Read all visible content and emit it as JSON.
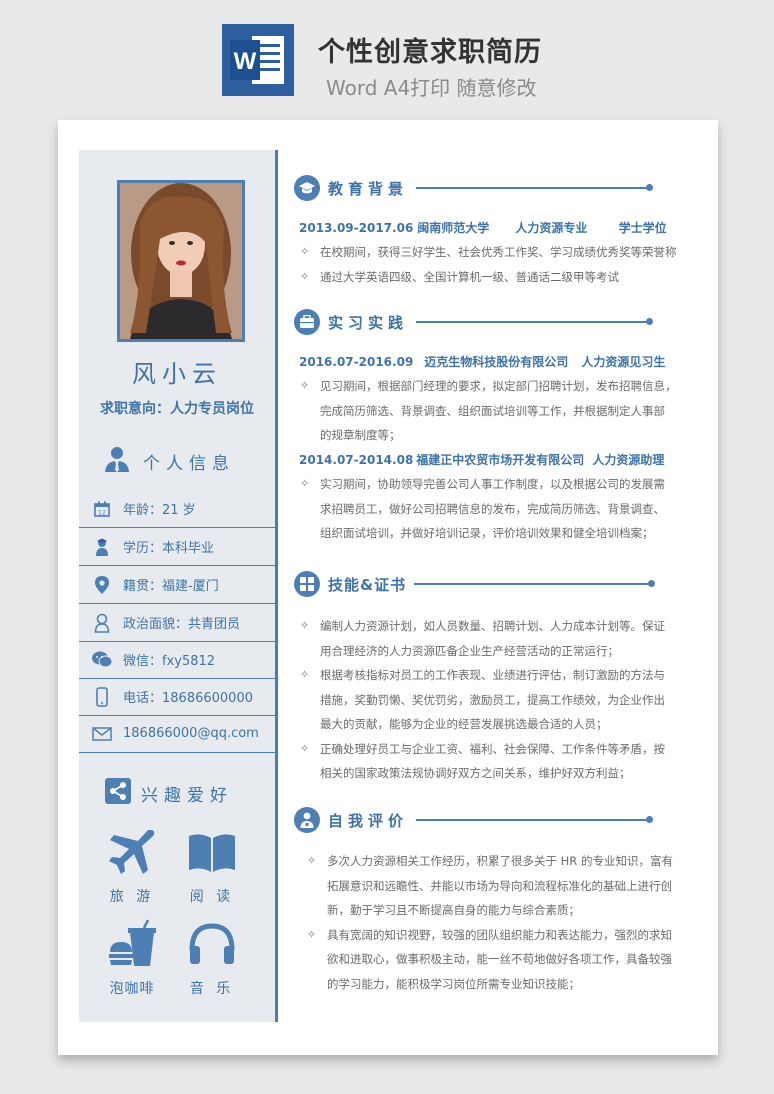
{
  "header": {
    "logo_letter": "W",
    "title": "个性创意求职简历",
    "subtitle": "Word A4打印 随意修改"
  },
  "profile": {
    "name": "风小云",
    "intent": "求职意向：人力专员岗位"
  },
  "personal_info": {
    "title": "个人信息",
    "items": [
      {
        "icon": "calendar-icon",
        "text": "年龄：21 岁"
      },
      {
        "icon": "graduate-icon",
        "text": "学历：本科毕业"
      },
      {
        "icon": "location-pin-icon",
        "text": "籍贯：福建-厦门"
      },
      {
        "icon": "person-icon",
        "text": "政治面貌：共青团员"
      },
      {
        "icon": "wechat-icon",
        "text": "微信：fxy5812"
      },
      {
        "icon": "phone-icon",
        "text": "电话：18686600000"
      },
      {
        "icon": "mail-icon",
        "text": "186866000@qq.com"
      }
    ]
  },
  "hobbies": {
    "title": "兴趣爱好",
    "items": [
      {
        "icon": "airplane-icon",
        "label": "旅 游"
      },
      {
        "icon": "book-icon",
        "label": "阅 读"
      },
      {
        "icon": "coffee-burger-icon",
        "label": "泡咖啡"
      },
      {
        "icon": "headphones-icon",
        "label": "音 乐"
      }
    ]
  },
  "education": {
    "title": "教育背景",
    "period": "2013.09-2017.06",
    "school": "闽南师范大学",
    "major": "人力资源专业",
    "degree": "学士学位",
    "bullets": [
      "在校期间，获得三好学生、社会优秀工作奖、学习成绩优秀奖等荣誉称",
      "通过大学英语四级、全国计算机一级、普通话二级甲等考试"
    ]
  },
  "internship": {
    "title": "实习实践",
    "jobs": [
      {
        "period": "2016.07-2016.09",
        "company": "迈克生物科技股份有限公司",
        "role": "人力资源见习生",
        "lines": [
          "见习期间，根据部门经理的要求，拟定部门招聘计划，发布招聘信息，",
          "完成简历筛选、背景调查、组织面试培训等工作，并根据制定人事部",
          "的规章制度等；"
        ]
      },
      {
        "period": "2014.07-2014.08",
        "company": "福建正中农贸市场开发有限公司",
        "role": "人力资源助理",
        "lines": [
          "实习期间，协助领导完善公司人事工作制度，以及根据公司的发展需",
          "求招聘员工，做好公司招聘信息的发布，完成简历筛选、背景调查、",
          "组织面试培训，并做好培训记录，评价培训效果和健全培训档案；"
        ]
      }
    ]
  },
  "skills": {
    "title": "技能&证书",
    "bullets": [
      [
        "编制人力资源计划，如人员数量、招聘计划、人力成本计划等。保证",
        "用合理经济的人力资源匹备企业生产经营活动的正常运行；"
      ],
      [
        "根据考核指标对员工的工作表现、业绩进行评估，制订激励的方法与",
        "措施，奖勤罚懒、奖优罚劣，激励员工，提高工作绩效，为企业作出",
        "最大的贡献，能够为企业的经营发展挑选最合适的人员；"
      ],
      [
        "正确处理好员工与企业工资、福利、社会保障、工作条件等矛盾，按",
        "相关的国家政策法规协调好双方之间关系，维护好双方利益；"
      ]
    ]
  },
  "self_eval": {
    "title": "自我评价",
    "bullets": [
      [
        "多次人力资源相关工作经历，积累了很多关于 HR 的专业知识，富有",
        "拓展意识和远瞻性、并能以市场为导向和流程标准化的基础上进行创",
        "新，勤于学习且不断提高自身的能力与综合素质；"
      ],
      [
        "具有宽阔的知识视野，较强的团队组织能力和表达能力，强烈的求知",
        "欲和进取心，做事积极主动，能一丝不苟地做好各项工作，具备较强",
        "的学习能力，能积极学习岗位所需专业知识技能；"
      ]
    ]
  },
  "colors": {
    "accent": "#3f73a8",
    "sidebar_bg": "#e7ebef",
    "text": "#6b6b6b"
  }
}
